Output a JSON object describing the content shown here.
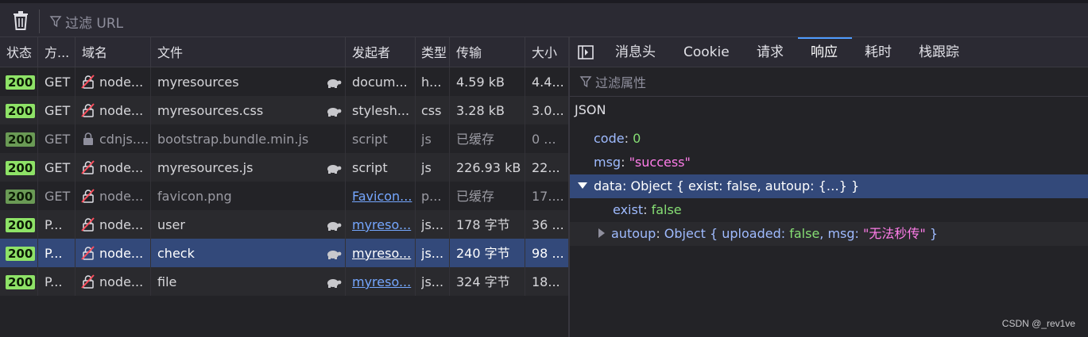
{
  "toolbar": {
    "filter_placeholder": "过滤 URL"
  },
  "columns": [
    "状态",
    "方...",
    "域名",
    "文件",
    "发起者",
    "类型",
    "传输",
    "大小"
  ],
  "requests": [
    {
      "status": "200",
      "method": "GET",
      "domain": "node...",
      "file": "myresources",
      "initiator": "docum...",
      "type": "h...",
      "transfer": "4.59 kB",
      "size": "4.4...",
      "lock": "insecure",
      "initiator_link": false,
      "throttle": true
    },
    {
      "status": "200",
      "method": "GET",
      "domain": "node...",
      "file": "myresources.css",
      "initiator": "stylesh...",
      "type": "css",
      "transfer": "3.28 kB",
      "size": "3.0...",
      "lock": "insecure",
      "initiator_link": false,
      "throttle": true
    },
    {
      "status": "200",
      "method": "GET",
      "domain": "cdnjs....",
      "file": "bootstrap.bundle.min.js",
      "initiator": "script",
      "type": "js",
      "transfer": "已缓存",
      "size": "0 ...",
      "lock": "secure",
      "initiator_link": false,
      "throttle": false,
      "cached": true
    },
    {
      "status": "200",
      "method": "GET",
      "domain": "node...",
      "file": "myresources.js",
      "initiator": "script",
      "type": "js",
      "transfer": "226.93 kB",
      "size": "22...",
      "lock": "insecure",
      "initiator_link": false,
      "throttle": true
    },
    {
      "status": "200",
      "method": "GET",
      "domain": "node...",
      "file": "favicon.png",
      "initiator": "Favicon...",
      "type": "p...",
      "transfer": "已缓存",
      "size": "17....",
      "lock": "insecure",
      "initiator_link": true,
      "throttle": false,
      "cached": true
    },
    {
      "status": "200",
      "method": "P...",
      "domain": "node...",
      "file": "user",
      "initiator": "myreso...",
      "type": "js...",
      "transfer": "178 字节",
      "size": "36 ...",
      "lock": "insecure",
      "initiator_link": true,
      "throttle": true
    },
    {
      "status": "200",
      "method": "P...",
      "domain": "node...",
      "file": "check",
      "initiator": "myreso...",
      "type": "js...",
      "transfer": "240 字节",
      "size": "98 ...",
      "lock": "insecure",
      "initiator_link": true,
      "throttle": true,
      "selected": true
    },
    {
      "status": "200",
      "method": "P...",
      "domain": "node...",
      "file": "file",
      "initiator": "myreso...",
      "type": "js...",
      "transfer": "324 字节",
      "size": "18...",
      "lock": "insecure",
      "initiator_link": true,
      "throttle": true
    }
  ],
  "panel": {
    "tabs": [
      "消息头",
      "Cookie",
      "请求",
      "响应",
      "耗时",
      "栈跟踪"
    ],
    "active_tab": "响应",
    "filter_placeholder": "过滤属性",
    "json_label": "JSON",
    "tree": {
      "code_key": "code",
      "code_val": "0",
      "msg_key": "msg",
      "msg_val": "\"success\"",
      "data_key": "data",
      "data_summary": "Object { exist: false, autoup: {…} }",
      "exist_key": "exist",
      "exist_val": "false",
      "autoup_key": "autoup",
      "autoup_pre": "Object { uploaded: ",
      "autoup_uploaded": "false",
      "autoup_mid": ", msg: ",
      "autoup_msg": "\"无法秒传\"",
      "autoup_post": " }"
    }
  },
  "watermark": "CSDN @_rev1ve",
  "colors": {
    "status_ok": "#8ee267",
    "selected_row": "#33497a",
    "link": "#75a7ff",
    "string": "#ff7de9",
    "number": "#86de74"
  }
}
